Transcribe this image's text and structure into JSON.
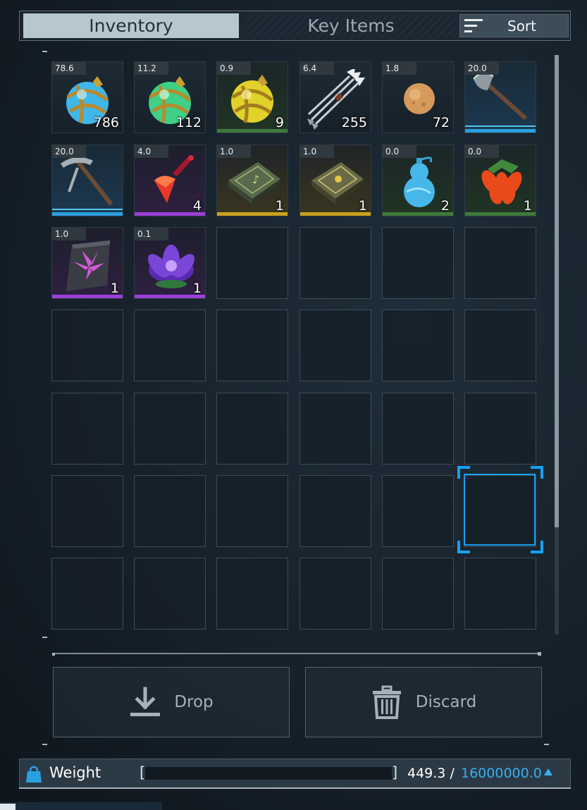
{
  "tabs": {
    "inventory": "Inventory",
    "key_items": "Key Items",
    "sort": "Sort"
  },
  "actions": {
    "drop": "Drop",
    "discard": "Discard"
  },
  "weight": {
    "label": "Weight",
    "current": "449.3",
    "separator": "/",
    "max": "16000000.0",
    "fill_fraction": 2.8e-05
  },
  "selected_slot": 35,
  "items": [
    {
      "name": "Pal Sphere (blue)",
      "weight": "78.6",
      "qty": "786",
      "icon": "sphere-blue-icon",
      "rarity": "common"
    },
    {
      "name": "Pal Sphere (green)",
      "weight": "11.2",
      "qty": "112",
      "icon": "sphere-green-icon",
      "rarity": "common"
    },
    {
      "name": "Pal Sphere (yellow)",
      "weight": "0.9",
      "qty": "9",
      "icon": "sphere-yellow-icon",
      "rarity": "green"
    },
    {
      "name": "Arrows",
      "weight": "6.4",
      "qty": "255",
      "icon": "arrows-icon",
      "rarity": "common"
    },
    {
      "name": "Round item",
      "weight": "1.8",
      "qty": "72",
      "icon": "orb-brown-icon",
      "rarity": "common"
    },
    {
      "name": "Axe",
      "weight": "20.0",
      "qty": "",
      "icon": "axe-icon",
      "rarity": "blue"
    },
    {
      "name": "Pickaxe",
      "weight": "20.0",
      "qty": "",
      "icon": "pickaxe-icon",
      "rarity": "blue"
    },
    {
      "name": "Red gem",
      "weight": "4.0",
      "qty": "4",
      "icon": "red-gem-icon",
      "rarity": "purple"
    },
    {
      "name": "Book (green)",
      "weight": "1.0",
      "qty": "1",
      "icon": "book-green-icon",
      "rarity": "gold"
    },
    {
      "name": "Book (gold)",
      "weight": "1.0",
      "qty": "1",
      "icon": "book-gold-icon",
      "rarity": "gold"
    },
    {
      "name": "Blue gourd",
      "weight": "0.0",
      "qty": "2",
      "icon": "gourd-icon",
      "rarity": "green"
    },
    {
      "name": "Red flower",
      "weight": "0.0",
      "qty": "1",
      "icon": "red-flower-icon",
      "rarity": "green"
    },
    {
      "name": "Stone tablet",
      "weight": "1.0",
      "qty": "1",
      "icon": "stone-tablet-icon",
      "rarity": "purple"
    },
    {
      "name": "Purple lotus",
      "weight": "0.1",
      "qty": "1",
      "icon": "purple-lotus-icon",
      "rarity": "purple"
    }
  ],
  "rarity_colors": {
    "common": "",
    "green": "#3f7a3a",
    "blue": "#2aa0e0",
    "purple": "#9a3fd8",
    "gold": "#c9a21b"
  },
  "grid": {
    "columns": 6,
    "rows": 7
  }
}
